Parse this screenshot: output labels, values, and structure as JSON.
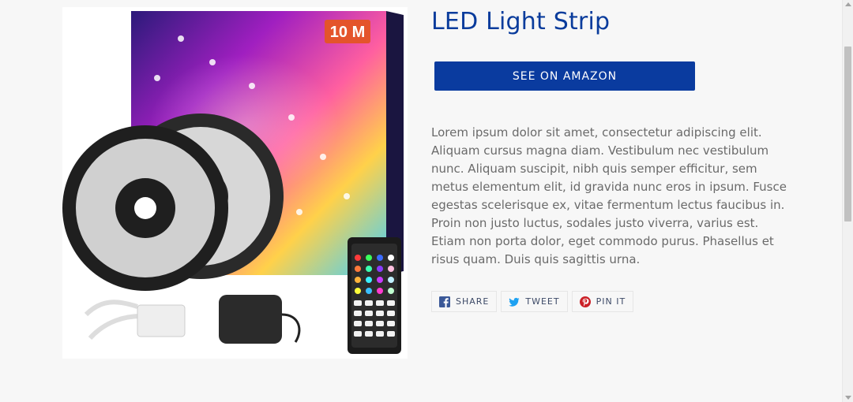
{
  "product": {
    "title": "LED Light Strip",
    "image_alt": "LED light strip kit with remote, controller and power adapter",
    "box_badge": "10 M",
    "amazon_button_label": "SEE ON AMAZON",
    "description": "Lorem ipsum dolor sit amet, consectetur adipiscing elit. Aliquam cursus magna diam. Vestibulum nec vestibulum nunc. Aliquam suscipit, nibh quis semper efficitur, sem metus elementum elit, id gravida nunc eros in ipsum. Fusce egestas scelerisque ex, vitae fermentum lectus faucibus in. Proin non justo luctus, sodales justo viverra, varius est. Etiam non porta dolor, eget commodo purus. Phasellus et risus quam. Duis quis sagittis urna."
  },
  "share": [
    {
      "name": "share-facebook-button",
      "icon": "facebook-icon",
      "label": "SHARE",
      "color": "#3b5998"
    },
    {
      "name": "share-twitter-button",
      "icon": "twitter-icon",
      "label": "TWEET",
      "color": "#1da1f2"
    },
    {
      "name": "share-pinterest-button",
      "icon": "pinterest-icon",
      "label": "PIN IT",
      "color": "#cb2027"
    }
  ],
  "colors": {
    "accent": "#0a3b9f",
    "title": "#0a3c9c",
    "background": "#f7f7f7",
    "body_text": "#6a6a6a"
  }
}
